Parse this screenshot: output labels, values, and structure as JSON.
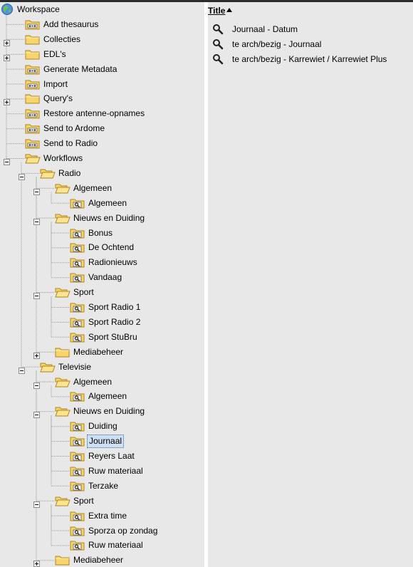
{
  "tree": {
    "root_label": "Workspace",
    "items": [
      {
        "label": "Add thesaurus",
        "icon": "query-folder-icon",
        "depth": 1,
        "expand": "none"
      },
      {
        "label": "Collecties",
        "icon": "folder-icon",
        "depth": 1,
        "expand": "plus"
      },
      {
        "label": "EDL's",
        "icon": "folder-icon",
        "depth": 1,
        "expand": "plus"
      },
      {
        "label": "Generate Metadata",
        "icon": "query-folder-icon",
        "depth": 1,
        "expand": "none"
      },
      {
        "label": "Import",
        "icon": "query-folder-icon",
        "depth": 1,
        "expand": "none"
      },
      {
        "label": "Query's",
        "icon": "folder-icon",
        "depth": 1,
        "expand": "plus"
      },
      {
        "label": "Restore antenne-opnames",
        "icon": "query-folder-icon",
        "depth": 1,
        "expand": "none"
      },
      {
        "label": "Send to Ardome",
        "icon": "query-folder-icon",
        "depth": 1,
        "expand": "none"
      },
      {
        "label": "Send to Radio",
        "icon": "query-folder-icon",
        "depth": 1,
        "expand": "none"
      },
      {
        "label": "Workflows",
        "icon": "open-folder-icon",
        "depth": 1,
        "expand": "minus"
      },
      {
        "label": "Radio",
        "icon": "open-folder-icon",
        "depth": 2,
        "expand": "minus"
      },
      {
        "label": "Algemeen",
        "icon": "open-folder-icon",
        "depth": 3,
        "expand": "minus"
      },
      {
        "label": "Algemeen",
        "icon": "search-folder-icon",
        "depth": 4,
        "expand": "none"
      },
      {
        "label": "Nieuws en Duiding",
        "icon": "open-folder-icon",
        "depth": 3,
        "expand": "minus"
      },
      {
        "label": "Bonus",
        "icon": "search-folder-icon",
        "depth": 4,
        "expand": "none"
      },
      {
        "label": "De Ochtend",
        "icon": "search-folder-icon",
        "depth": 4,
        "expand": "none"
      },
      {
        "label": "Radionieuws",
        "icon": "search-folder-icon",
        "depth": 4,
        "expand": "none"
      },
      {
        "label": "Vandaag",
        "icon": "search-folder-icon",
        "depth": 4,
        "expand": "none"
      },
      {
        "label": "Sport",
        "icon": "open-folder-icon",
        "depth": 3,
        "expand": "minus"
      },
      {
        "label": "Sport Radio 1",
        "icon": "search-folder-icon",
        "depth": 4,
        "expand": "none"
      },
      {
        "label": "Sport Radio 2",
        "icon": "search-folder-icon",
        "depth": 4,
        "expand": "none"
      },
      {
        "label": "Sport StuBru",
        "icon": "search-folder-icon",
        "depth": 4,
        "expand": "none"
      },
      {
        "label": "Mediabeheer",
        "icon": "folder-icon",
        "depth": 3,
        "expand": "plus"
      },
      {
        "label": "Televisie",
        "icon": "open-folder-icon",
        "depth": 2,
        "expand": "minus"
      },
      {
        "label": "Algemeen",
        "icon": "open-folder-icon",
        "depth": 3,
        "expand": "minus"
      },
      {
        "label": "Algemeen",
        "icon": "search-folder-icon",
        "depth": 4,
        "expand": "none"
      },
      {
        "label": "Nieuws en Duiding",
        "icon": "open-folder-icon",
        "depth": 3,
        "expand": "minus"
      },
      {
        "label": "Duiding",
        "icon": "search-folder-icon",
        "depth": 4,
        "expand": "none"
      },
      {
        "label": "Journaal",
        "icon": "search-folder-icon",
        "depth": 4,
        "expand": "none",
        "selected": true
      },
      {
        "label": "Reyers Laat",
        "icon": "search-folder-icon",
        "depth": 4,
        "expand": "none"
      },
      {
        "label": "Ruw materiaal",
        "icon": "search-folder-icon",
        "depth": 4,
        "expand": "none"
      },
      {
        "label": "Terzake",
        "icon": "search-folder-icon",
        "depth": 4,
        "expand": "none"
      },
      {
        "label": "Sport",
        "icon": "open-folder-icon",
        "depth": 3,
        "expand": "minus"
      },
      {
        "label": "Extra time",
        "icon": "search-folder-icon",
        "depth": 4,
        "expand": "none"
      },
      {
        "label": "Sporza op zondag",
        "icon": "search-folder-icon",
        "depth": 4,
        "expand": "none"
      },
      {
        "label": "Ruw materiaal",
        "icon": "search-folder-icon",
        "depth": 4,
        "expand": "none"
      },
      {
        "label": "Mediabeheer",
        "icon": "folder-icon",
        "depth": 3,
        "expand": "plus"
      }
    ]
  },
  "results": {
    "column_title": "Title",
    "sort_icon": "sort-ascending-icon",
    "rows": [
      {
        "label": "Journaal - Datum",
        "icon": "search-icon"
      },
      {
        "label": "te arch/bezig - Journaal",
        "icon": "search-icon"
      },
      {
        "label": "te arch/bezig - Karrewiet / Karrewiet Plus",
        "icon": "search-icon"
      }
    ]
  },
  "colors": {
    "pane_background": "#e8e8e8",
    "folder_fill": "#f7d56a",
    "folder_stroke": "#b08420",
    "selection_background": "#cfe0f3"
  }
}
